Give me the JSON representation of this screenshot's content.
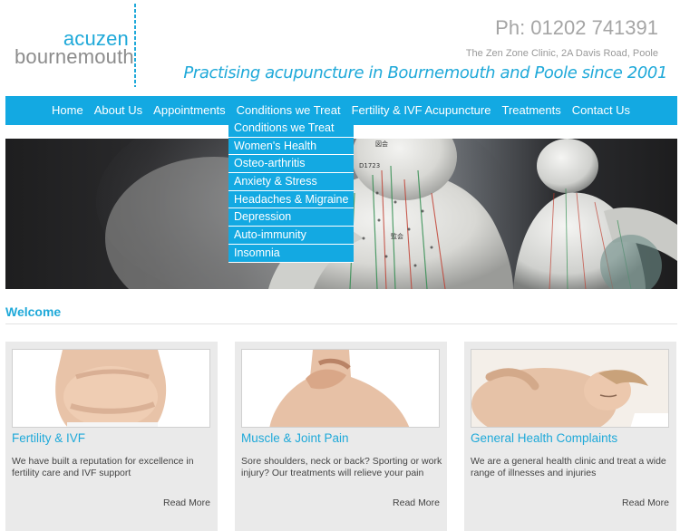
{
  "header": {
    "logo_top": "acuzen",
    "logo_bottom": "bournemouth",
    "phone": "Ph: 01202 741391",
    "address": "The Zen Zone Clinic, 2A Davis Road, Poole",
    "tagline": "Practising acupuncture in Bournemouth and Poole since 2001"
  },
  "nav": {
    "items": [
      {
        "label": "Home"
      },
      {
        "label": "About Us"
      },
      {
        "label": "Appointments"
      },
      {
        "label": "Conditions we Treat"
      },
      {
        "label": "Fertility & IVF Acupuncture"
      },
      {
        "label": "Treatments"
      },
      {
        "label": "Contact Us"
      }
    ]
  },
  "dropdown": {
    "items": [
      {
        "label": "Conditions we Treat"
      },
      {
        "label": "Women's Health"
      },
      {
        "label": "Osteo-arthritis"
      },
      {
        "label": "Anxiety & Stress"
      },
      {
        "label": "Headaches & Migraine"
      },
      {
        "label": "Depression"
      },
      {
        "label": "Auto-immunity"
      },
      {
        "label": "Insomnia"
      }
    ]
  },
  "hero": {
    "labels": [
      "図会",
      "D1723",
      "監会"
    ]
  },
  "main": {
    "welcome": "Welcome",
    "cards": [
      {
        "title": "Fertility & IVF",
        "text": "We have built a reputation for excellence in fertility care and IVF support",
        "more": "Read More"
      },
      {
        "title": "Muscle & Joint Pain",
        "text": "Sore shoulders, neck or back? Sporting or work injury? Our treatments will relieve your pain",
        "more": "Read More"
      },
      {
        "title": "General Health Complaints",
        "text": "We are a general health clinic and treat a wide range of illnesses and injuries",
        "more": "Read More"
      }
    ]
  },
  "colors": {
    "accent": "#13a9e2",
    "accent_text": "#1fa9d9",
    "card_bg": "#eaeaea"
  }
}
